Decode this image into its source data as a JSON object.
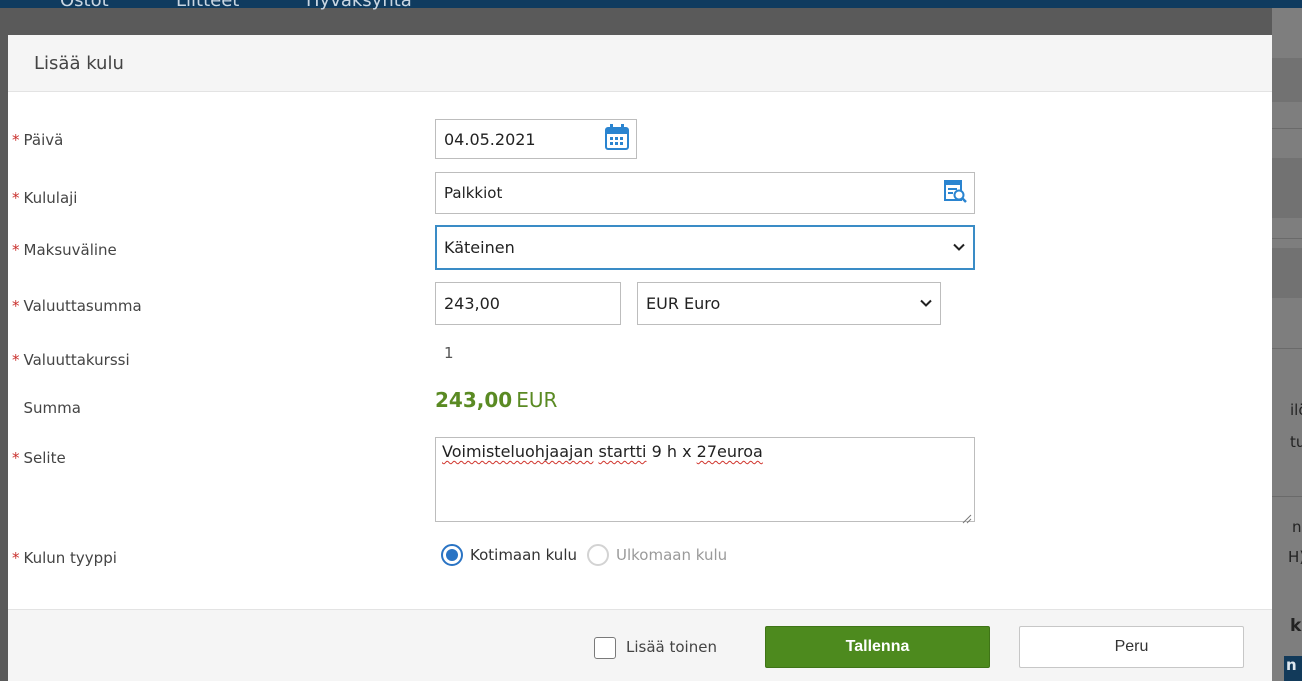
{
  "background": {
    "nav_tabs": [
      "Ostot",
      "Liitteet",
      "Hyväksyntä"
    ],
    "right_fragments": [
      "ilö",
      "tu",
      "nis",
      "H)",
      "ku",
      "n"
    ]
  },
  "modal": {
    "title": "Lisää kulu",
    "fields": {
      "paiva": {
        "label": "Päivä",
        "required": true,
        "value": "04.05.2021"
      },
      "kululaji": {
        "label": "Kululaji",
        "required": true,
        "value": "Palkkiot"
      },
      "maksuvaline": {
        "label": "Maksuväline",
        "required": true,
        "value": "Käteinen"
      },
      "valuuttasumma": {
        "label": "Valuuttasumma",
        "required": true,
        "value": "243,00",
        "currency": "EUR Euro"
      },
      "valuuttakurssi": {
        "label": "Valuuttakurssi",
        "required": true,
        "value": "1"
      },
      "summa": {
        "label": "Summa",
        "required": false,
        "amount": "243,00",
        "currency": "EUR"
      },
      "selite": {
        "label": "Selite",
        "required": true,
        "words": [
          "Voimisteluohjaajan",
          "startti",
          "9",
          "h",
          "x",
          "27euroa"
        ]
      },
      "kulun_tyyppi": {
        "label": "Kulun tyyppi",
        "required": true,
        "options": [
          "Kotimaan kulu",
          "Ulkomaan kulu"
        ],
        "selected": "Kotimaan kulu"
      }
    },
    "footer": {
      "add_another_label": "Lisää toinen",
      "add_another_checked": false,
      "save_label": "Tallenna",
      "cancel_label": "Peru"
    }
  },
  "colors": {
    "required_star": "#c9302c",
    "primary_button": "#4d8a1e",
    "amount_text": "#5a8a23",
    "focus_border": "#3a8cc6",
    "radio_accent": "#2a74c4",
    "nav_bar": "#0f3b5f"
  }
}
